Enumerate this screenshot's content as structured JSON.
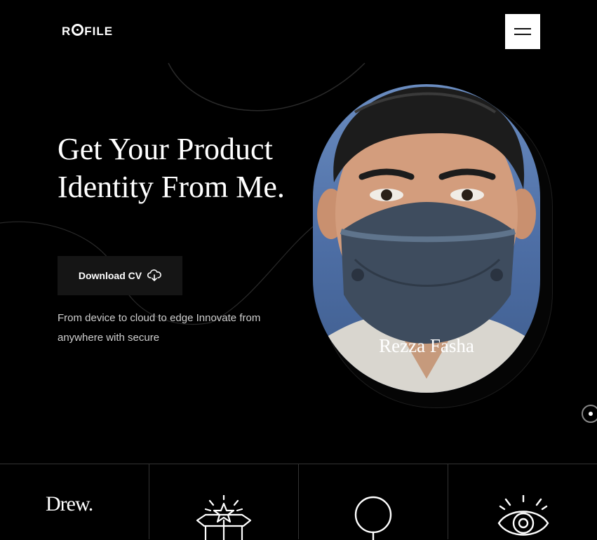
{
  "header": {
    "logo_text_a": "R",
    "logo_text_b": "FILE",
    "menu_icon": "hamburger-icon"
  },
  "hero": {
    "headline": "Get Your Product Identity From Me.",
    "cta_label": "Download CV",
    "cta_icon": "cloud-download-icon",
    "description": "From device to cloud to edge Innovate from anywhere with secure"
  },
  "portrait": {
    "name": "Rezza Fasha"
  },
  "features": {
    "brand": "Drew.",
    "icons": [
      "gift-box-star-icon",
      "lightbulb-icon",
      "eye-icon"
    ]
  },
  "colors": {
    "background": "#000000",
    "button": "#151515",
    "text": "#ffffff"
  }
}
